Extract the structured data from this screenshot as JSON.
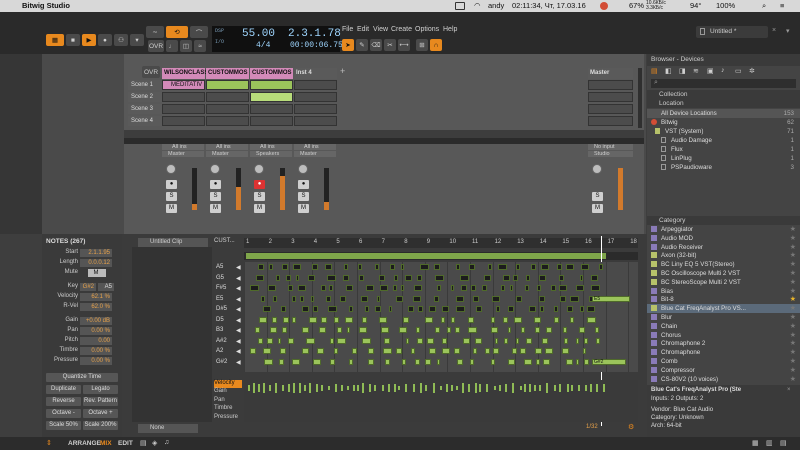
{
  "menubar": {
    "app_name": "Bitwig Studio",
    "clock": "02:11:34, Чт, 17.03.16",
    "user": "andy",
    "battery_pct": "67%",
    "net_up": "10.6КБ/с",
    "net_down": "3.3КБ/с",
    "cpu_temp": "94°",
    "volume_pct": "100%"
  },
  "transport": {
    "ovr": "OVR",
    "dsp_label": "DSP",
    "io_label": "I/O",
    "tempo": "55.00",
    "signature": "4/4",
    "position": "2.3.1.78",
    "time": "00:00:06.75",
    "menu": [
      "File",
      "Edit",
      "View",
      "Create",
      "Options",
      "Help"
    ],
    "doc_tab": "Untitled *"
  },
  "tracks": [
    {
      "name": "WILSONCLASS",
      "color": "#d38ab9"
    },
    {
      "name": "CUSTOMMOS",
      "color": "#d38ab9"
    },
    {
      "name": "CUSTOMMOS",
      "color": "#d38ab9"
    },
    {
      "name": "Inst 4",
      "color": "#6f6f6f"
    }
  ],
  "master_track": "Master",
  "master_input": "No input",
  "master_output": "Studio",
  "scenes": [
    "Scene 1",
    "Scene 2",
    "Scene 3",
    "Scene 4"
  ],
  "clip_meditativ": "MEDITATIV",
  "mixer_strips": [
    {
      "input": "All ins",
      "output": "Master"
    },
    {
      "input": "All ins",
      "output": "Master"
    },
    {
      "input": "All ins",
      "output": "Speakers"
    },
    {
      "input": "All ins",
      "output": "Master"
    }
  ],
  "meter_levels": [
    0.15,
    0.55,
    0.8,
    0.2
  ],
  "inspector": {
    "title": "NOTES (267)",
    "start_label": "Start",
    "start": "2.1.1.95",
    "length_label": "Length",
    "length": "0.0.0.12",
    "mute_label": "Mute",
    "mute": "M",
    "key_label": "Key",
    "key": "G#2",
    "key2": "A5",
    "velocity_label": "Velocity",
    "velocity": "62.1 %",
    "rvel_label": "R-Vel",
    "rvel": "62.0 %",
    "gain_label": "Gain",
    "gain": "+0.00 dB",
    "pan_label": "Pan",
    "pan": "0.00 %",
    "pitch_label": "Pitch",
    "pitch": "0.00",
    "timbre_label": "Timbre",
    "timbre": "0.00 %",
    "pressure_label": "Pressure",
    "pressure": "0.00 %",
    "quantize": "Quantize Time",
    "duplicate": "Duplicate",
    "legato": "Legato",
    "reverse": "Reverse",
    "rev_pattern": "Rev. Pattern",
    "octave_down": "Octave -",
    "octave_up": "Octave +",
    "scale_down": "Scale 50%",
    "scale_up": "Scale 200%"
  },
  "pianoroll": {
    "clip_name": "Untitled Clip",
    "cust_label": "CUST...",
    "ruler": [
      "1",
      "2",
      "3",
      "4",
      "5",
      "6",
      "7",
      "8",
      "9",
      "10",
      "11",
      "12",
      "13",
      "14",
      "15",
      "16",
      "17",
      "18"
    ],
    "keys": [
      "A5",
      "G5",
      "F#5",
      "E5",
      "D#5",
      "D5",
      "B3",
      "A#2",
      "A2",
      "G#2"
    ],
    "lanes": [
      "Velocity",
      "Gain",
      "Pan",
      "Timbre",
      "Pressure"
    ],
    "none_label": "None",
    "grid": "1/32",
    "note_label": "G#2",
    "note_label2": "E5"
  },
  "browser": {
    "title": "Browser - Devices",
    "collection": "Collection",
    "location": "Location",
    "items": [
      {
        "name": "All Device Locations",
        "count": "153"
      },
      {
        "name": "Bitwig",
        "count": "62"
      },
      {
        "name": "VST (System)",
        "count": "71"
      },
      {
        "name": "Audio Damage",
        "count": "1"
      },
      {
        "name": "Flux",
        "count": "1"
      },
      {
        "name": "LinPlug",
        "count": "1"
      },
      {
        "name": "PSPaudioware",
        "count": "3"
      }
    ],
    "category": "Category",
    "devices": [
      "Arpeggiator",
      "Audio MOD",
      "Audio Receiver",
      "Axon (32-bit)",
      "BC Liny EQ 5 VST(Stereo)",
      "BC Oscilloscope Multi 2 VST",
      "BC StereoScope Multi 2 VST",
      "Bias",
      "Bit-8",
      "Blue Cat FreqAnalyst Pro VS...",
      "Blur",
      "Chain",
      "Chorus",
      "Chromaphone 2",
      "Chromaphone",
      "Comb",
      "Compressor",
      "CS-80V2 (10 voices)"
    ],
    "detail_title": "Blue Cat's FreqAnalyst Pro (Ste",
    "detail_io": "Inputs: 2    Outputs: 2",
    "detail_vendor": "Vendor: Blue Cat Audio",
    "detail_category": "Category: Unknown",
    "detail_arch": "Arch: 64-bit"
  },
  "bottombar": {
    "arrange": "ARRANGE",
    "mix": "MIX",
    "edit": "EDIT"
  },
  "colors": {
    "accent": "#e8891e",
    "clip_green": "#9bc45b",
    "clip_pink": "#d38ab9"
  }
}
